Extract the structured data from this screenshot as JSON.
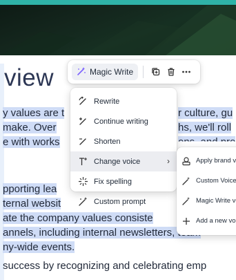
{
  "document": {
    "title": "view",
    "lines": [
      "y values are t",
      "make. Over",
      "e with works",
      "pporting lea",
      "ternal websit",
      "ate the company values consiste",
      "annels, including internal newsletters, team",
      "ny-wide events.",
      "success by recognizing and celebrating emp"
    ],
    "right_fragments": [
      "r culture, gu",
      "hs, we'll roll",
      "ons, and pro"
    ]
  },
  "toolbar": {
    "magic_write_label": "Magic Write",
    "icons": [
      "magic-write-icon",
      "duplicate-icon",
      "trash-icon",
      "more-icon"
    ]
  },
  "menu": {
    "items": [
      {
        "label": "Rewrite",
        "icon": "rewrite-icon"
      },
      {
        "label": "Continue writing",
        "icon": "continue-writing-icon"
      },
      {
        "label": "Shorten",
        "icon": "shorten-icon"
      },
      {
        "label": "Change voice",
        "icon": "change-voice-icon",
        "has_submenu": true,
        "chevron": "›"
      },
      {
        "label": "Fix spelling",
        "icon": "fix-spelling-icon"
      },
      {
        "label": "Custom prompt",
        "icon": "custom-prompt-icon"
      }
    ]
  },
  "submenu": {
    "items": [
      {
        "label": "Apply brand voice",
        "icon": "brand-voice-icon"
      },
      {
        "label": "Custom Voice",
        "icon": "magic-wand-icon"
      },
      {
        "label": "Magic Write voice",
        "icon": "magic-wand-icon"
      },
      {
        "label": "Add a new voice",
        "icon": "plus-icon"
      }
    ]
  },
  "colors": {
    "highlight": "#cfdcf6",
    "title": "#2c3654",
    "accent_teal": "#2fb3a8"
  }
}
